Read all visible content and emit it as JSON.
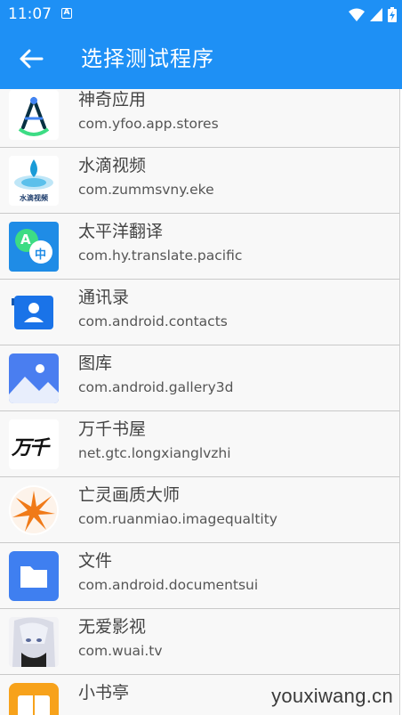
{
  "status_bar": {
    "time": "11:07",
    "notification_icon": "a-box-icon",
    "icons": [
      "wifi-icon",
      "signal-icon",
      "battery-charging-icon"
    ]
  },
  "app_bar": {
    "back_icon": "arrow-left-icon",
    "title": "选择测试程序",
    "color": "#1e90f5"
  },
  "apps": [
    {
      "name": "神奇应用",
      "package": "com.yfoo.app.stores",
      "icon": "compass-icon"
    },
    {
      "name": "水滴视频",
      "package": "com.zummsvny.eke",
      "icon": "water-drop-icon"
    },
    {
      "name": "太平洋翻译",
      "package": "com.hy.translate.pacific",
      "icon": "translate-icon"
    },
    {
      "name": "通讯录",
      "package": "com.android.contacts",
      "icon": "contacts-icon"
    },
    {
      "name": "图库",
      "package": "com.android.gallery3d",
      "icon": "gallery-icon"
    },
    {
      "name": "万千书屋",
      "package": "net.gtc.longxianglvzhi",
      "icon": "calligraphy-icon"
    },
    {
      "name": "亡灵画质大师",
      "package": "com.ruanmiao.imagequaltity",
      "icon": "burst-icon"
    },
    {
      "name": "文件",
      "package": "com.android.documentsui",
      "icon": "folder-icon"
    },
    {
      "name": "无爱影视",
      "package": "com.wuai.tv",
      "icon": "anime-avatar-icon"
    },
    {
      "name": "小书亭",
      "package": "",
      "icon": "book-icon"
    }
  ],
  "watermark": "youxiwang.cn",
  "icon_text": {
    "compass": "",
    "water_drop": "水滴视频",
    "translate_a": "A",
    "translate_zh": "中",
    "calligraphy": "万千"
  }
}
